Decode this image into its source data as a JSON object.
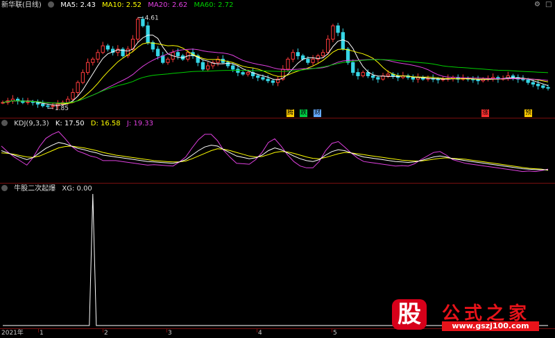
{
  "main_panel": {
    "stock_name": "新华联(日线)",
    "indicators": [
      {
        "label": "MA5: 2.43",
        "color": "#ffffff"
      },
      {
        "label": "MA10: 2.52",
        "color": "#ffff00"
      },
      {
        "label": "MA20: 2.62",
        "color": "#e040e0"
      },
      {
        "label": "MA60: 2.72",
        "color": "#00d000"
      }
    ],
    "high_label": "4.61",
    "low_label": "1.85",
    "badges": [
      {
        "text": "腾",
        "color": "#ffcc00"
      },
      {
        "text": "跌",
        "color": "#00cc44"
      },
      {
        "text": "财",
        "color": "#66aaff"
      },
      {
        "text": "涨",
        "color": "#ff3030"
      },
      {
        "text": "预",
        "color": "#ffcc00"
      }
    ]
  },
  "kdj_panel": {
    "title": "KDJ(9,3,3)",
    "values": [
      {
        "label": "K: 17.50",
        "color": "#ffffff"
      },
      {
        "label": "D: 16.58",
        "color": "#ffff00"
      },
      {
        "label": "J: 19.33",
        "color": "#e040e0"
      }
    ]
  },
  "xg_panel": {
    "title": "牛股二次起爆",
    "value_label": "XG: 0.00"
  },
  "xaxis": {
    "labels": [
      "2021年",
      "1",
      "2",
      "3",
      "4",
      "5"
    ]
  },
  "window_buttons": {
    "settings": "⚙",
    "close": "□"
  },
  "watermark": {
    "logo": "股",
    "title": "公式之家",
    "url": "www.gszj100.com"
  },
  "chart_data": [
    {
      "type": "candlestick",
      "title": "新华联(日线)",
      "ylabel": "",
      "ylim": [
        1.85,
        4.61
      ],
      "series": [
        {
          "name": "MA5",
          "color": "#ffffff",
          "last": 2.43
        },
        {
          "name": "MA10",
          "color": "#ffff00",
          "last": 2.52
        },
        {
          "name": "MA20",
          "color": "#e040e0",
          "last": 2.62
        },
        {
          "name": "MA60",
          "color": "#00d000",
          "last": 2.72
        }
      ],
      "annotations": [
        "4.61",
        "1.85"
      ],
      "close": [
        2.0,
        2.05,
        2.1,
        2.05,
        2.0,
        2.02,
        2.0,
        1.95,
        1.9,
        1.88,
        1.9,
        1.95,
        2.0,
        2.1,
        2.3,
        2.6,
        2.9,
        3.2,
        3.3,
        3.5,
        3.7,
        3.6,
        3.5,
        3.6,
        3.4,
        3.6,
        3.9,
        4.5,
        4.3,
        3.8,
        3.6,
        3.4,
        3.2,
        3.3,
        3.5,
        3.4,
        3.3,
        3.5,
        3.4,
        3.2,
        3.0,
        3.1,
        3.2,
        3.3,
        3.2,
        3.1,
        3.0,
        2.9,
        2.85,
        2.9,
        2.8,
        2.75,
        2.7,
        2.65,
        2.6,
        2.7,
        3.0,
        3.3,
        3.5,
        3.4,
        3.3,
        3.2,
        3.3,
        3.4,
        3.5,
        3.9,
        4.3,
        4.1,
        3.6,
        3.2,
        2.9,
        2.8,
        2.9,
        2.8,
        2.75,
        2.7,
        2.8,
        2.85,
        2.8,
        2.75,
        2.8,
        2.75,
        2.7,
        2.75,
        2.7,
        2.72,
        2.7,
        2.68,
        2.7,
        2.72,
        2.75,
        2.7,
        2.72,
        2.7,
        2.68,
        2.65,
        2.7,
        2.72,
        2.75,
        2.7,
        2.72,
        2.8,
        2.75,
        2.7,
        2.68,
        2.6,
        2.55,
        2.5,
        2.45,
        2.43
      ]
    },
    {
      "type": "line",
      "title": "KDJ(9,3,3)",
      "series": [
        {
          "name": "K",
          "color": "#ffffff",
          "last": 17.5
        },
        {
          "name": "D",
          "color": "#ffff00",
          "last": 16.58
        },
        {
          "name": "J",
          "color": "#e040e0",
          "last": 19.33
        }
      ],
      "ylim": [
        0,
        100
      ],
      "K": [
        60,
        55,
        50,
        45,
        40,
        45,
        55,
        65,
        72,
        78,
        75,
        70,
        65,
        62,
        58,
        55,
        50,
        48,
        46,
        44,
        42,
        40,
        38,
        36,
        35,
        34,
        33,
        32,
        35,
        40,
        50,
        60,
        68,
        72,
        70,
        62,
        55,
        48,
        45,
        42,
        44,
        50,
        60,
        66,
        62,
        55,
        48,
        42,
        38,
        36,
        40,
        50,
        58,
        62,
        60,
        55,
        50,
        46,
        44,
        42,
        40,
        38,
        36,
        35,
        34,
        35,
        38,
        42,
        46,
        48,
        46,
        42,
        40,
        38,
        36,
        34,
        32,
        30,
        28,
        26,
        24,
        22,
        20,
        19,
        18,
        18,
        17.5
      ],
      "D": [
        55,
        54,
        52,
        49,
        46,
        45,
        48,
        54,
        60,
        66,
        69,
        70,
        68,
        66,
        63,
        60,
        56,
        53,
        50,
        48,
        46,
        44,
        42,
        40,
        38,
        37,
        36,
        35,
        35,
        37,
        42,
        48,
        54,
        60,
        64,
        63,
        60,
        56,
        52,
        48,
        46,
        47,
        51,
        56,
        58,
        57,
        54,
        50,
        46,
        43,
        42,
        45,
        49,
        53,
        56,
        55,
        53,
        51,
        49,
        47,
        45,
        43,
        41,
        39,
        38,
        37,
        37,
        39,
        41,
        43,
        44,
        43,
        42,
        41,
        39,
        37,
        35,
        33,
        31,
        29,
        27,
        25,
        23,
        21,
        20,
        19,
        16.58
      ],
      "J": [
        70,
        57,
        46,
        37,
        28,
        45,
        69,
        87,
        96,
        102,
        87,
        70,
        59,
        54,
        48,
        45,
        38,
        38,
        38,
        36,
        34,
        32,
        30,
        28,
        29,
        28,
        27,
        26,
        35,
        46,
        66,
        84,
        96,
        96,
        82,
        60,
        45,
        32,
        31,
        30,
        40,
        56,
        78,
        86,
        70,
        51,
        36,
        26,
        22,
        22,
        36,
        60,
        76,
        80,
        68,
        55,
        44,
        36,
        34,
        32,
        30,
        28,
        26,
        27,
        26,
        31,
        40,
        48,
        56,
        58,
        50,
        40,
        36,
        32,
        30,
        28,
        26,
        24,
        22,
        20,
        18,
        16,
        14,
        15,
        14,
        16,
        19.33
      ]
    },
    {
      "type": "line",
      "title": "牛股二次起爆",
      "series": [
        {
          "name": "XG",
          "color": "#ffffff",
          "last": 0.0
        }
      ],
      "spike_index": 18,
      "values_note_visible": false
    }
  ]
}
